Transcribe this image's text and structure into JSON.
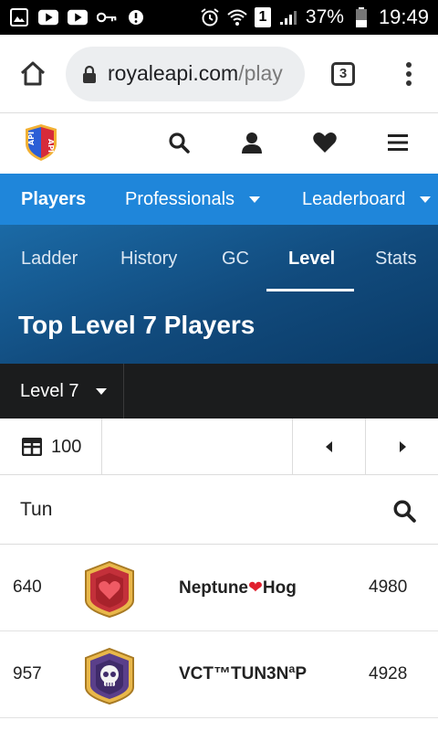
{
  "status_bar": {
    "battery_percent": "37%",
    "time": "19:49",
    "sim_number": "1"
  },
  "browser": {
    "url_host": "royaleapi.com",
    "url_path": "/play",
    "tab_count": "3"
  },
  "main_nav": {
    "items": [
      {
        "label": "Players",
        "active": true
      },
      {
        "label": "Professionals",
        "dropdown": true
      },
      {
        "label": "Leaderboard",
        "dropdown": true
      }
    ]
  },
  "sub_nav": {
    "tabs": [
      {
        "label": "Ladder"
      },
      {
        "label": "History"
      },
      {
        "label": "GC"
      },
      {
        "label": "Level",
        "active": true
      },
      {
        "label": "Stats"
      }
    ]
  },
  "page_title": "Top Level 7 Players",
  "level_selector": {
    "value": "Level 7"
  },
  "pager": {
    "page_size": "100"
  },
  "search": {
    "value": "Tun",
    "placeholder": ""
  },
  "players": [
    {
      "rank": "640",
      "name_prefix": "Neptune",
      "name_symbol": "❤",
      "name_suffix": "Hog",
      "score": "4980",
      "badge": "heart-badge"
    },
    {
      "rank": "957",
      "name_prefix": "VCT™TUN3Nª",
      "name_symbol": "",
      "name_suffix": "P",
      "score": "4928",
      "badge": "skull-badge"
    }
  ],
  "colors": {
    "nav_blue": "#1f86da",
    "subnav_dark_blue": "#114a7c",
    "level_bar": "#1b1c1d"
  }
}
